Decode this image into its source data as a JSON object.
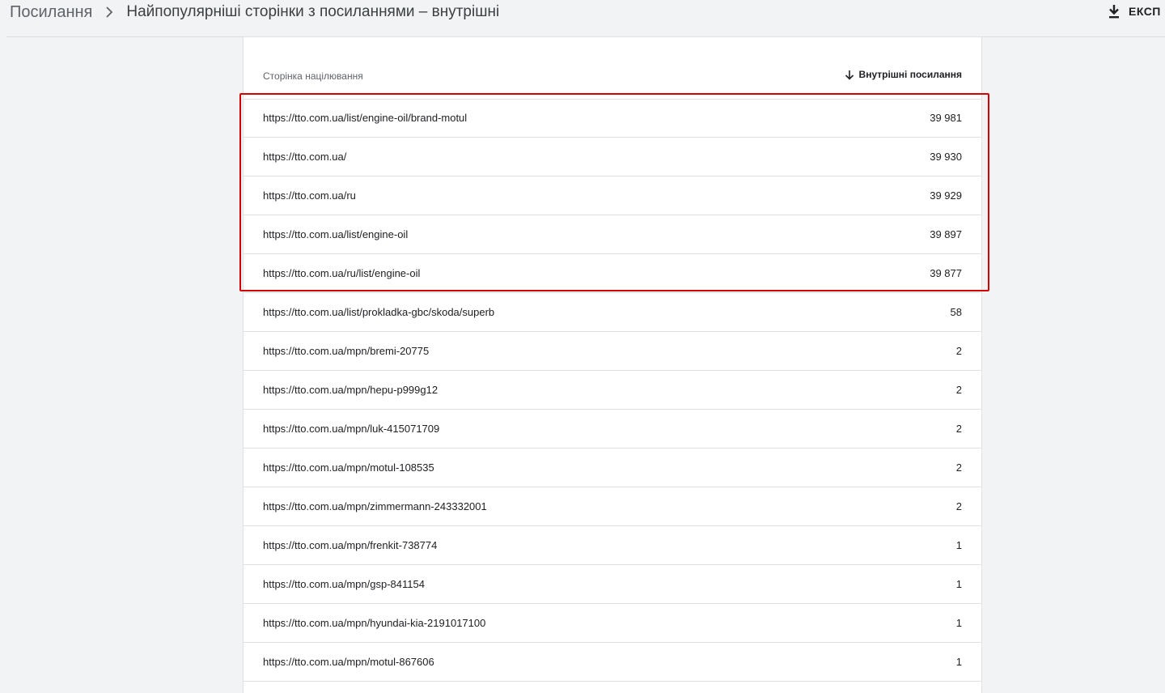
{
  "breadcrumb": {
    "root": "Посилання",
    "current": "Найпопулярніші сторінки з посиланнями – внутрішні"
  },
  "toolbar": {
    "export_label": "ЕКСП"
  },
  "table": {
    "columns": {
      "page": "Сторінка націлювання",
      "links": "Внутрішні посилання"
    },
    "rows": [
      {
        "url": "https://tto.com.ua/list/engine-oil/brand-motul",
        "count": "39 981"
      },
      {
        "url": "https://tto.com.ua/",
        "count": "39 930"
      },
      {
        "url": "https://tto.com.ua/ru",
        "count": "39 929"
      },
      {
        "url": "https://tto.com.ua/list/engine-oil",
        "count": "39 897"
      },
      {
        "url": "https://tto.com.ua/ru/list/engine-oil",
        "count": "39 877"
      },
      {
        "url": "https://tto.com.ua/list/prokladka-gbc/skoda/superb",
        "count": "58"
      },
      {
        "url": "https://tto.com.ua/mpn/bremi-20775",
        "count": "2"
      },
      {
        "url": "https://tto.com.ua/mpn/hepu-p999g12",
        "count": "2"
      },
      {
        "url": "https://tto.com.ua/mpn/luk-415071709",
        "count": "2"
      },
      {
        "url": "https://tto.com.ua/mpn/motul-108535",
        "count": "2"
      },
      {
        "url": "https://tto.com.ua/mpn/zimmermann-243332001",
        "count": "2"
      },
      {
        "url": "https://tto.com.ua/mpn/frenkit-738774",
        "count": "1"
      },
      {
        "url": "https://tto.com.ua/mpn/gsp-841154",
        "count": "1"
      },
      {
        "url": "https://tto.com.ua/mpn/hyundai-kia-2191017100",
        "count": "1"
      },
      {
        "url": "https://tto.com.ua/mpn/motul-867606",
        "count": "1"
      }
    ]
  },
  "colors": {
    "highlight": "#d60000",
    "background": "#f1f3f4",
    "divider": "#e0e0e0"
  },
  "icons": {
    "separator": "chevron-right-icon",
    "export": "download-icon",
    "sort": "arrow-down-icon"
  }
}
